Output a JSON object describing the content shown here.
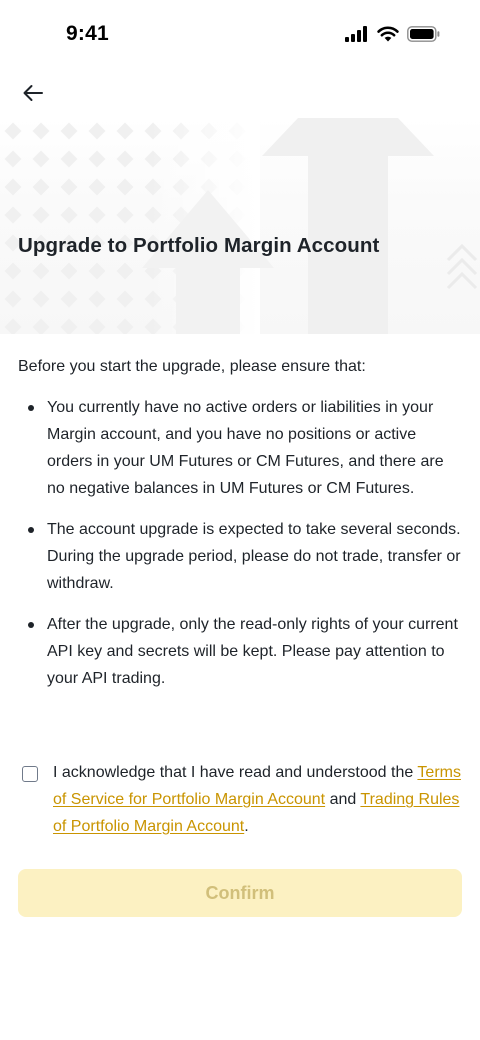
{
  "status_bar": {
    "time": "9:41",
    "icons": [
      "signal-icon",
      "wifi-icon",
      "battery-icon"
    ]
  },
  "header": {
    "back_icon": "arrow-left-icon",
    "title": "Upgrade to Portfolio Margin Account"
  },
  "content": {
    "intro": "Before you start the upgrade, please ensure that:",
    "bullets": [
      "You currently have no active orders or liabilities in your Margin account, and you have no positions or active orders in your UM Futures or CM Futures, and there are no negative balances in UM Futures or CM Futures.",
      "The account upgrade is expected to take several seconds. During the upgrade period, please do not trade, transfer or withdraw.",
      "After the upgrade, only the read-only rights of your current API key and secrets will be kept. Please pay attention to your API trading."
    ]
  },
  "acknowledge": {
    "checked": false,
    "prefix": "I acknowledge that I have read and understood the ",
    "link_terms": "Terms of Service for Portfolio Margin Account",
    "connector": " and ",
    "link_rules": "Trading Rules of Portfolio Margin Account",
    "suffix": "."
  },
  "footer": {
    "confirm_label": "Confirm"
  },
  "colors": {
    "text": "#1e2329",
    "link": "#c99400",
    "button_disabled_bg": "#fcf1c2",
    "button_disabled_text": "#d1bf7a"
  }
}
